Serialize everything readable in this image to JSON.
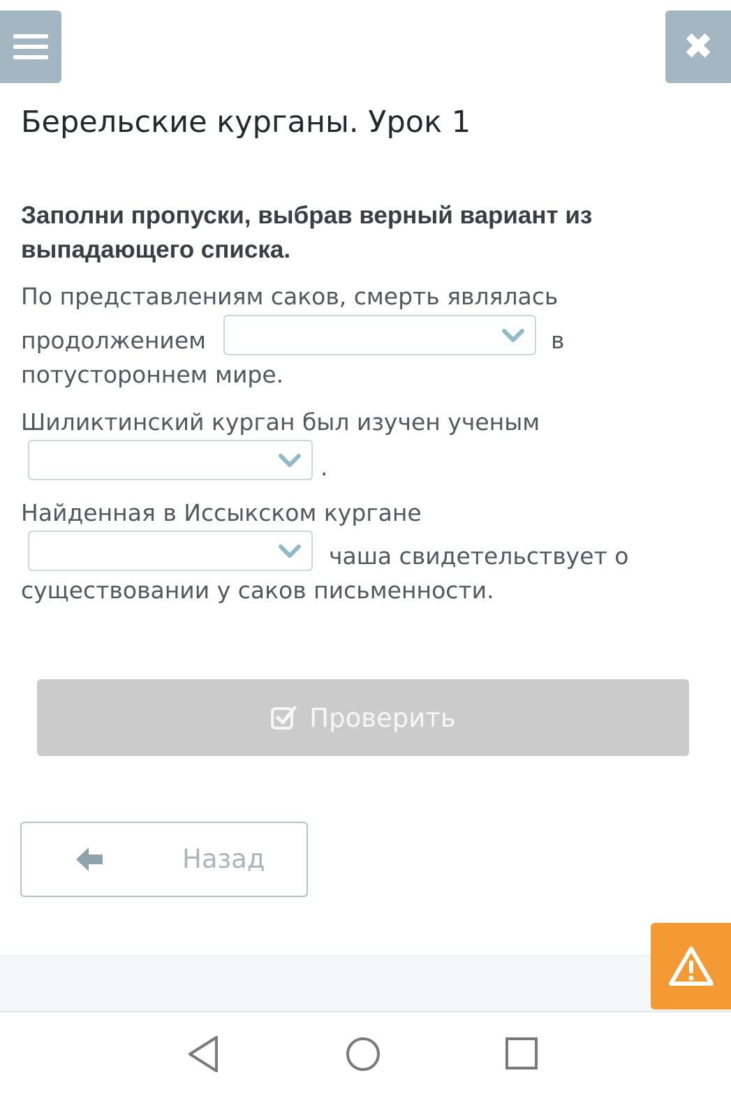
{
  "header": {
    "menu_icon": "hamburger-menu-icon",
    "close_icon": "close-icon",
    "close_glyph": "✖",
    "title": "Берельские курганы. Урок 1"
  },
  "task": {
    "instruction_line1": "Заполни пропуски, выбрав верный вариант из",
    "instruction_line2": "выпадающего списка.",
    "q1": {
      "line1": "По представлениям саков, смерть являлась",
      "before": "продолжением",
      "after": "в",
      "line3": "потустороннем мире.",
      "selected": ""
    },
    "q2": {
      "line1": "Шиликтинский курган был изучен ученым",
      "after": ".",
      "selected": ""
    },
    "q3": {
      "line1": "Найденная в Иссыкском кургане",
      "after": "чаша свидетельствует о",
      "line3": "существовании у саков письменности.",
      "selected": ""
    }
  },
  "actions": {
    "check_label": "Проверить",
    "check_icon": "checkbox-check-icon",
    "back_label": "Назад",
    "back_icon": "arrow-left-icon"
  },
  "colors": {
    "top_buttons": "#a3b6c1",
    "chevron": "#8fbcc4",
    "check_button_disabled": "#cbcbcb",
    "warning": "#f39a35"
  }
}
